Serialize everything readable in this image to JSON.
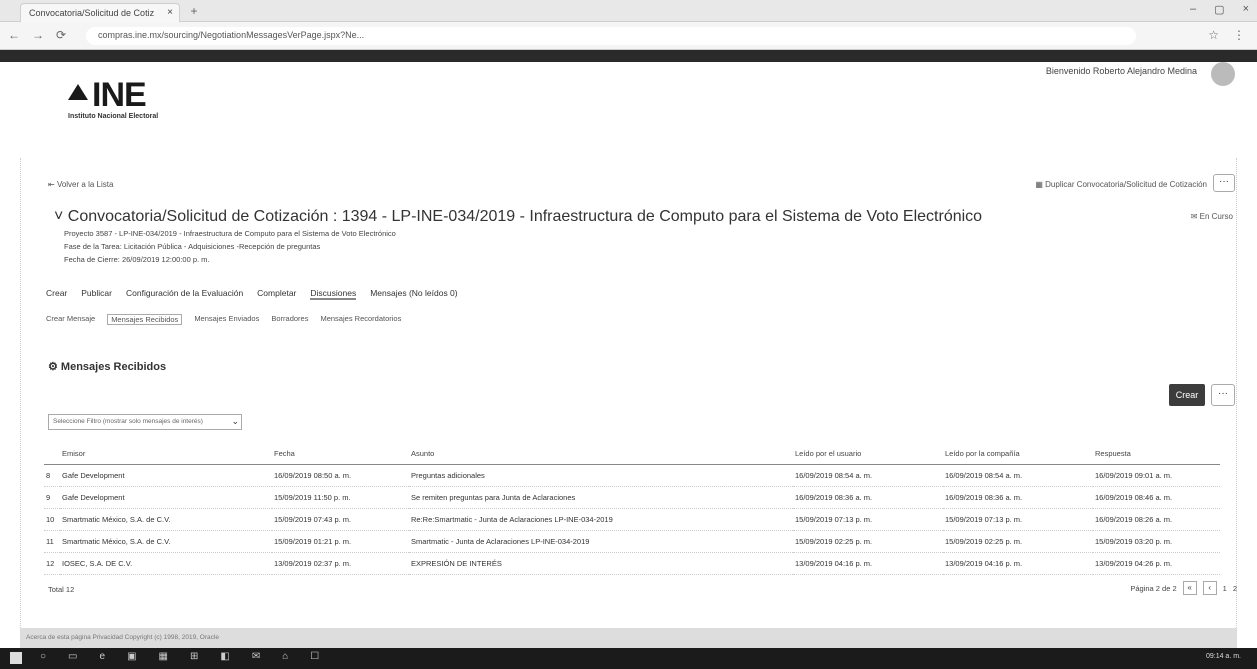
{
  "browser": {
    "tab_title": "Convocatoria/Solicitud de Cotiz",
    "tab_close": "×",
    "new_tab": "+",
    "url": "compras.ine.mx/sourcing/NegotiationMessagesVerPage.jspx?Ne...",
    "window_controls": [
      "–",
      "▢",
      "×"
    ],
    "nav_icons": [
      "←",
      "→",
      "⟳"
    ],
    "addr_icons": [
      "☆",
      "⋮"
    ]
  },
  "header": {
    "logo_text": "INE",
    "logo_subtitle": "Instituto Nacional Electoral",
    "welcome": "Bienvenido Roberto Alejandro Medina"
  },
  "toolbar": {
    "back_link": "Volver a la Lista",
    "duplicate_button": "Duplicar Convocatoria/Solicitud de Cotización",
    "more": "···"
  },
  "negotiation": {
    "title": "Convocatoria/Solicitud de Cotización : 1394 - LP-INE-034/2019 - Infraestructura de Computo para el Sistema de Voto Electrónico",
    "status": "En Curso",
    "project": "Proyecto 3587 - LP-INE-034/2019 - Infraestructura de Computo para el Sistema de Voto Electrónico",
    "phase": "Fase de la Tarea: Licitación Pública - Adquisiciones -Recepción de preguntas",
    "close_date": "Fecha de Cierre: 26/09/2019 12:00:00 p. m."
  },
  "top_nav": [
    "Crear",
    "Publicar",
    "Configuración de la Evaluación",
    "Completar",
    "Discusiones",
    "Mensajes (No leídos 0)"
  ],
  "top_nav_active": 4,
  "sub_nav": [
    "Crear Mensaje",
    "Mensajes Recibidos",
    "Mensajes Enviados",
    "Borradores",
    "Mensajes Recordatorios"
  ],
  "sub_nav_active": 1,
  "messages": {
    "section_title": "Mensajes Recibidos",
    "create_button": "Crear",
    "filter_placeholder": "Seleccione Filtro (mostrar solo mensajes de interés)",
    "columns": [
      "",
      "Emisor",
      "Fecha",
      "Asunto",
      "Leído por el usuario",
      "Leído por la compañía",
      "Respuesta"
    ],
    "rows": [
      [
        "8",
        "Gafe Development",
        "16/09/2019 08:50 a. m.",
        "Preguntas adicionales",
        "16/09/2019 08:54 a. m.",
        "16/09/2019 08:54 a. m.",
        "16/09/2019 09:01 a. m."
      ],
      [
        "9",
        "Gafe Development",
        "15/09/2019 11:50 p. m.",
        "Se remiten preguntas para Junta de Aclaraciones",
        "16/09/2019 08:36 a. m.",
        "16/09/2019 08:36 a. m.",
        "16/09/2019 08:46 a. m."
      ],
      [
        "10",
        "Smartmatic México, S.A. de C.V.",
        "15/09/2019 07:43 p. m.",
        "Re:Re:Smartmatic - Junta de Aclaraciones LP-INE-034-2019",
        "15/09/2019 07:13 p. m.",
        "15/09/2019 07:13 p. m.",
        "16/09/2019 08:26 a. m."
      ],
      [
        "11",
        "Smartmatic México, S.A. de C.V.",
        "15/09/2019 01:21 p. m.",
        "Smartmatic - Junta de Aclaraciones LP-INE-034-2019",
        "15/09/2019 02:25 p. m.",
        "15/09/2019 02:25 p. m.",
        "15/09/2019 03:20 p. m."
      ],
      [
        "12",
        "IOSEC, S.A. DE C.V.",
        "13/09/2019 02:37 p. m.",
        "EXPRESIÓN DE INTERÉS",
        "13/09/2019 04:16 p. m.",
        "13/09/2019 04:16 p. m.",
        "13/09/2019 04:26 p. m."
      ]
    ],
    "total": "Total 12",
    "page_label": "Página 2 de 2",
    "pages": [
      "1",
      "2"
    ]
  },
  "footer": {
    "text": "Acerca de esta página   Privacidad   Copyright (c) 1998, 2019, Oracle"
  },
  "taskbar": {
    "icons": [
      "○",
      "▭",
      "e",
      "▣",
      "▦",
      "⊞",
      "◧",
      "✉",
      "⌂",
      "☐"
    ],
    "clock": "09:14 a. m."
  }
}
